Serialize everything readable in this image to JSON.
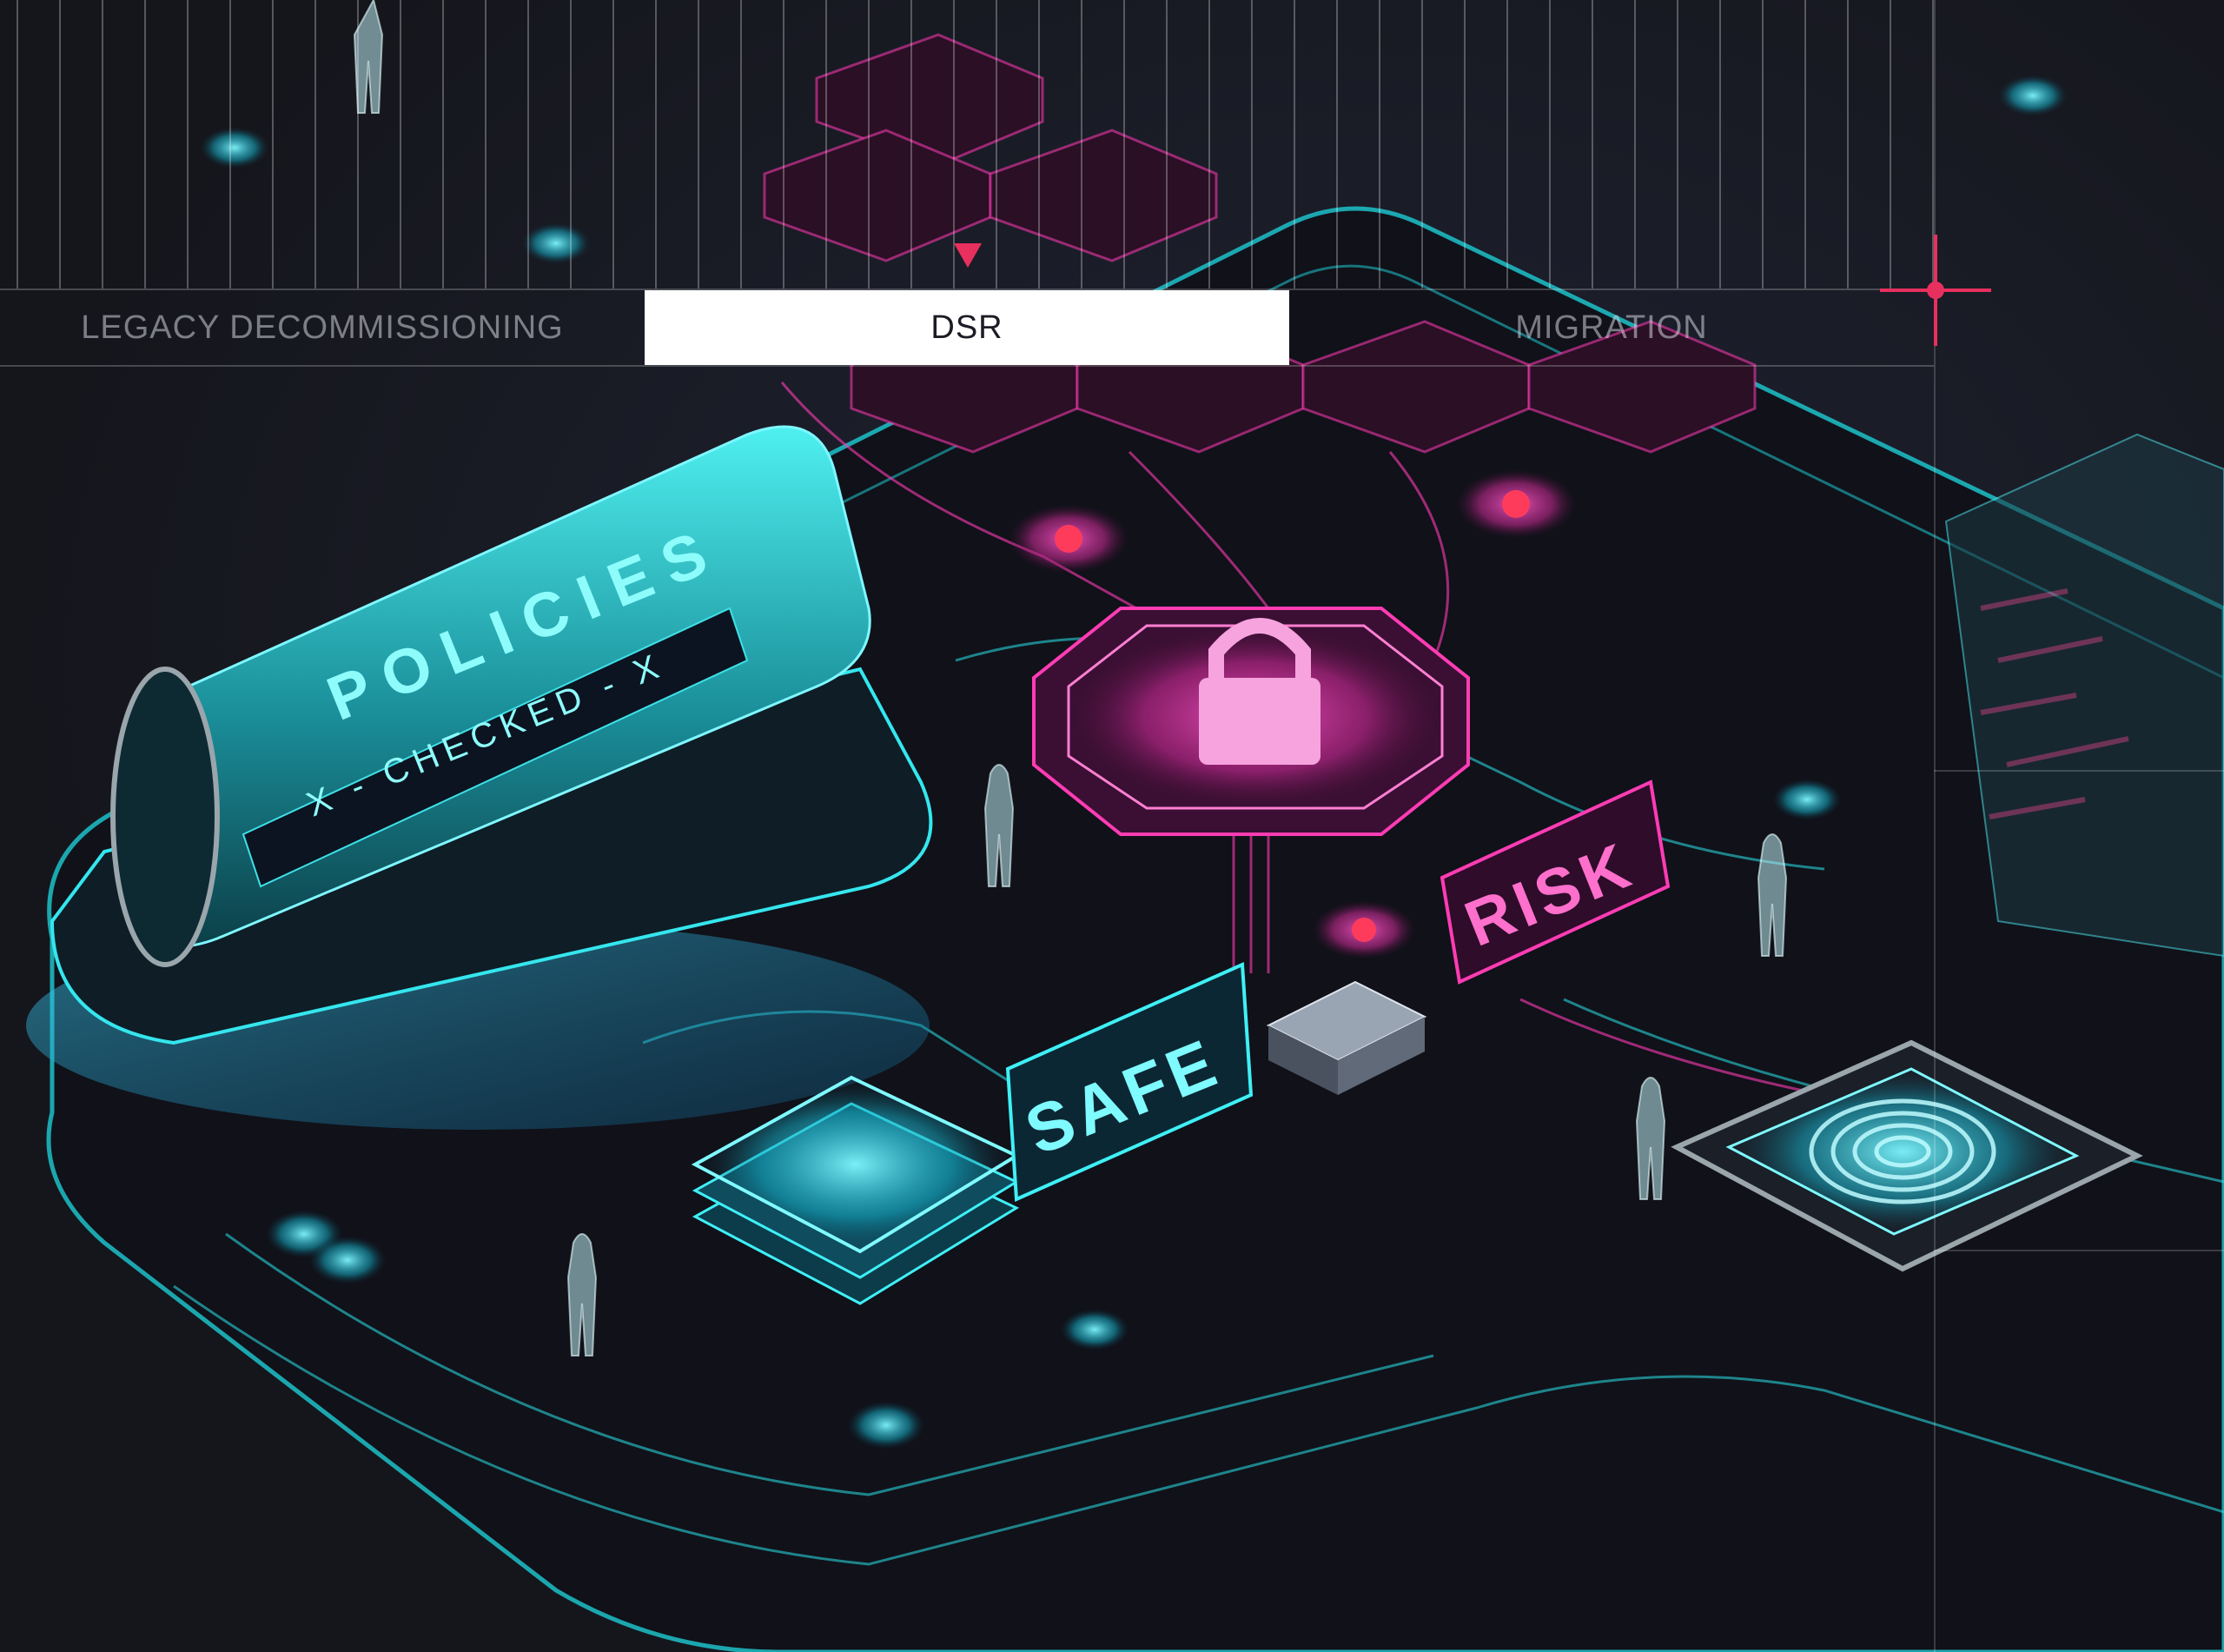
{
  "tabs": [
    {
      "label": "LEGACY DECOMMISSIONING",
      "active": false
    },
    {
      "label": "DSR",
      "active": true
    },
    {
      "label": "MIGRATION",
      "active": false
    }
  ],
  "illustration": {
    "policies_sign": "POLICIES",
    "checked_strip": "X - CHECKED - X",
    "safe_sign": "SAFE",
    "risk_sign": "RISK",
    "lock_icon": "lock-icon",
    "fingerprint_icon": "fingerprint-icon"
  },
  "colors": {
    "accent": "#e8305f",
    "cyan": "#34e6ee",
    "magenta": "#ff3cb4",
    "background": "#16171d",
    "active_tab_bg": "#ffffff"
  }
}
